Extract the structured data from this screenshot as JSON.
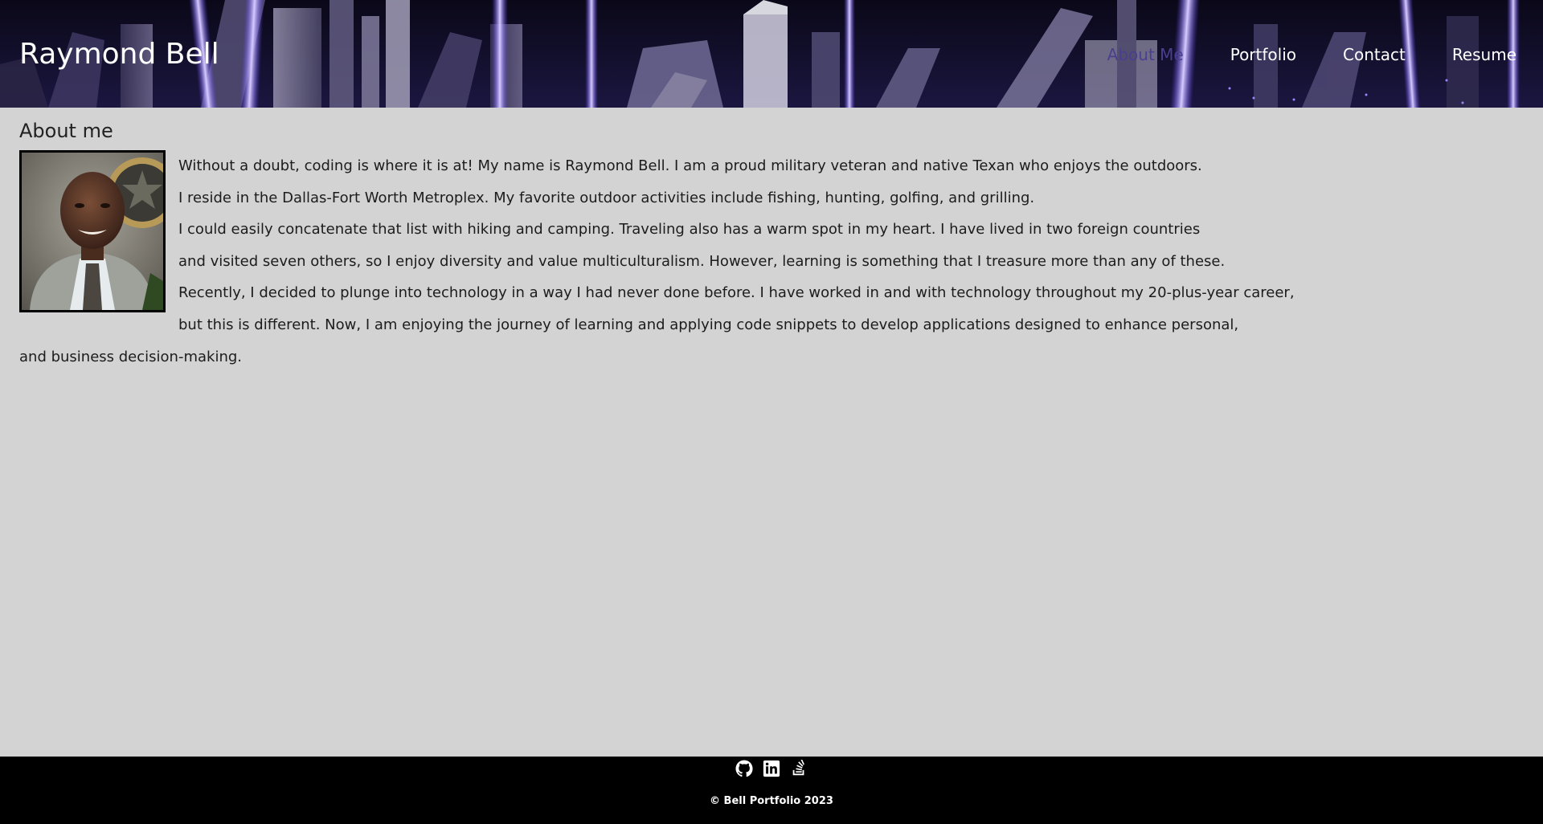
{
  "header": {
    "site_title": "Raymond Bell",
    "nav": [
      {
        "label": "About Me",
        "active": true
      },
      {
        "label": "Portfolio",
        "active": false
      },
      {
        "label": "Contact",
        "active": false
      },
      {
        "label": "Resume",
        "active": false
      }
    ],
    "colors": {
      "nav_active": "#4a3f8f",
      "nav_default": "#ffffff",
      "hero_glow": "#7b5cff"
    }
  },
  "main": {
    "section_title": "About me",
    "photo_icon": "profile-photo",
    "paragraph_lines": [
      "Without a doubt, coding is where it is at! My name is Raymond Bell. I am a proud military veteran and native Texan who enjoys the outdoors.",
      "I reside in the Dallas-Fort Worth Metroplex. My favorite outdoor activities include fishing, hunting, golfing, and grilling.",
      "I could easily concatenate that list with hiking and camping. Traveling also has a warm spot in my heart. I have lived in two foreign countries",
      "and visited seven others, so I enjoy diversity and value multiculturalism. However, learning is something that I treasure more than any of these.",
      "Recently, I decided to plunge into technology in a way I had never done before. I have worked in and with technology throughout my 20-plus-year career,",
      "but this is different. Now, I am enjoying the journey of learning and applying code snippets to develop applications designed to enhance personal,",
      "and business decision-making."
    ],
    "background_color": "#d3d3d3"
  },
  "footer": {
    "social": [
      {
        "icon": "github-icon"
      },
      {
        "icon": "linkedin-icon"
      },
      {
        "icon": "stack-overflow-icon"
      }
    ],
    "copyright": "© Bell Portfolio 2023",
    "background_color": "#000000"
  }
}
